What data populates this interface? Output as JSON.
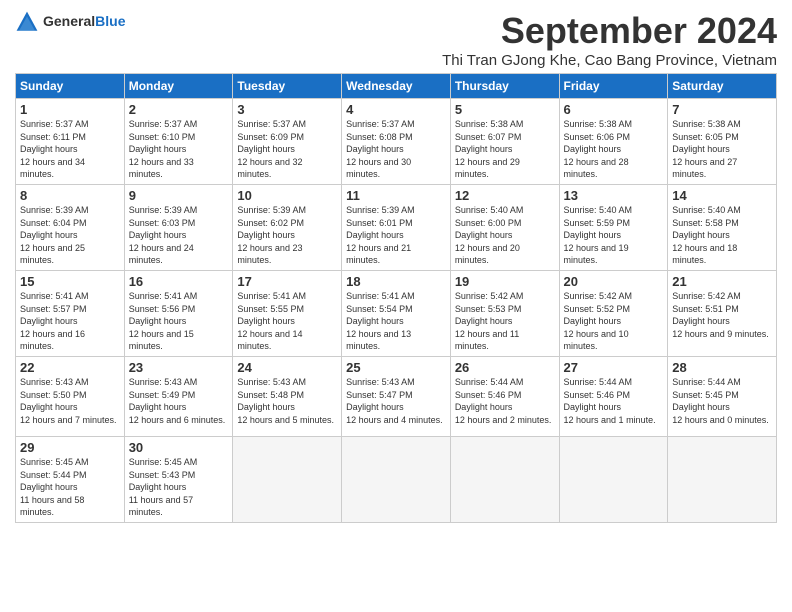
{
  "header": {
    "logo_general": "General",
    "logo_blue": "Blue",
    "month_title": "September 2024",
    "location": "Thi Tran GJong Khe, Cao Bang Province, Vietnam"
  },
  "days_of_week": [
    "Sunday",
    "Monday",
    "Tuesday",
    "Wednesday",
    "Thursday",
    "Friday",
    "Saturday"
  ],
  "weeks": [
    [
      {
        "day": "1",
        "sunrise": "5:37 AM",
        "sunset": "6:11 PM",
        "daylight": "12 hours and 34 minutes."
      },
      {
        "day": "2",
        "sunrise": "5:37 AM",
        "sunset": "6:10 PM",
        "daylight": "12 hours and 33 minutes."
      },
      {
        "day": "3",
        "sunrise": "5:37 AM",
        "sunset": "6:09 PM",
        "daylight": "12 hours and 32 minutes."
      },
      {
        "day": "4",
        "sunrise": "5:37 AM",
        "sunset": "6:08 PM",
        "daylight": "12 hours and 30 minutes."
      },
      {
        "day": "5",
        "sunrise": "5:38 AM",
        "sunset": "6:07 PM",
        "daylight": "12 hours and 29 minutes."
      },
      {
        "day": "6",
        "sunrise": "5:38 AM",
        "sunset": "6:06 PM",
        "daylight": "12 hours and 28 minutes."
      },
      {
        "day": "7",
        "sunrise": "5:38 AM",
        "sunset": "6:05 PM",
        "daylight": "12 hours and 27 minutes."
      }
    ],
    [
      {
        "day": "8",
        "sunrise": "5:39 AM",
        "sunset": "6:04 PM",
        "daylight": "12 hours and 25 minutes."
      },
      {
        "day": "9",
        "sunrise": "5:39 AM",
        "sunset": "6:03 PM",
        "daylight": "12 hours and 24 minutes."
      },
      {
        "day": "10",
        "sunrise": "5:39 AM",
        "sunset": "6:02 PM",
        "daylight": "12 hours and 23 minutes."
      },
      {
        "day": "11",
        "sunrise": "5:39 AM",
        "sunset": "6:01 PM",
        "daylight": "12 hours and 21 minutes."
      },
      {
        "day": "12",
        "sunrise": "5:40 AM",
        "sunset": "6:00 PM",
        "daylight": "12 hours and 20 minutes."
      },
      {
        "day": "13",
        "sunrise": "5:40 AM",
        "sunset": "5:59 PM",
        "daylight": "12 hours and 19 minutes."
      },
      {
        "day": "14",
        "sunrise": "5:40 AM",
        "sunset": "5:58 PM",
        "daylight": "12 hours and 18 minutes."
      }
    ],
    [
      {
        "day": "15",
        "sunrise": "5:41 AM",
        "sunset": "5:57 PM",
        "daylight": "12 hours and 16 minutes."
      },
      {
        "day": "16",
        "sunrise": "5:41 AM",
        "sunset": "5:56 PM",
        "daylight": "12 hours and 15 minutes."
      },
      {
        "day": "17",
        "sunrise": "5:41 AM",
        "sunset": "5:55 PM",
        "daylight": "12 hours and 14 minutes."
      },
      {
        "day": "18",
        "sunrise": "5:41 AM",
        "sunset": "5:54 PM",
        "daylight": "12 hours and 13 minutes."
      },
      {
        "day": "19",
        "sunrise": "5:42 AM",
        "sunset": "5:53 PM",
        "daylight": "12 hours and 11 minutes."
      },
      {
        "day": "20",
        "sunrise": "5:42 AM",
        "sunset": "5:52 PM",
        "daylight": "12 hours and 10 minutes."
      },
      {
        "day": "21",
        "sunrise": "5:42 AM",
        "sunset": "5:51 PM",
        "daylight": "12 hours and 9 minutes."
      }
    ],
    [
      {
        "day": "22",
        "sunrise": "5:43 AM",
        "sunset": "5:50 PM",
        "daylight": "12 hours and 7 minutes."
      },
      {
        "day": "23",
        "sunrise": "5:43 AM",
        "sunset": "5:49 PM",
        "daylight": "12 hours and 6 minutes."
      },
      {
        "day": "24",
        "sunrise": "5:43 AM",
        "sunset": "5:48 PM",
        "daylight": "12 hours and 5 minutes."
      },
      {
        "day": "25",
        "sunrise": "5:43 AM",
        "sunset": "5:47 PM",
        "daylight": "12 hours and 4 minutes."
      },
      {
        "day": "26",
        "sunrise": "5:44 AM",
        "sunset": "5:46 PM",
        "daylight": "12 hours and 2 minutes."
      },
      {
        "day": "27",
        "sunrise": "5:44 AM",
        "sunset": "5:46 PM",
        "daylight": "12 hours and 1 minute."
      },
      {
        "day": "28",
        "sunrise": "5:44 AM",
        "sunset": "5:45 PM",
        "daylight": "12 hours and 0 minutes."
      }
    ],
    [
      {
        "day": "29",
        "sunrise": "5:45 AM",
        "sunset": "5:44 PM",
        "daylight": "11 hours and 58 minutes."
      },
      {
        "day": "30",
        "sunrise": "5:45 AM",
        "sunset": "5:43 PM",
        "daylight": "11 hours and 57 minutes."
      },
      null,
      null,
      null,
      null,
      null
    ]
  ]
}
